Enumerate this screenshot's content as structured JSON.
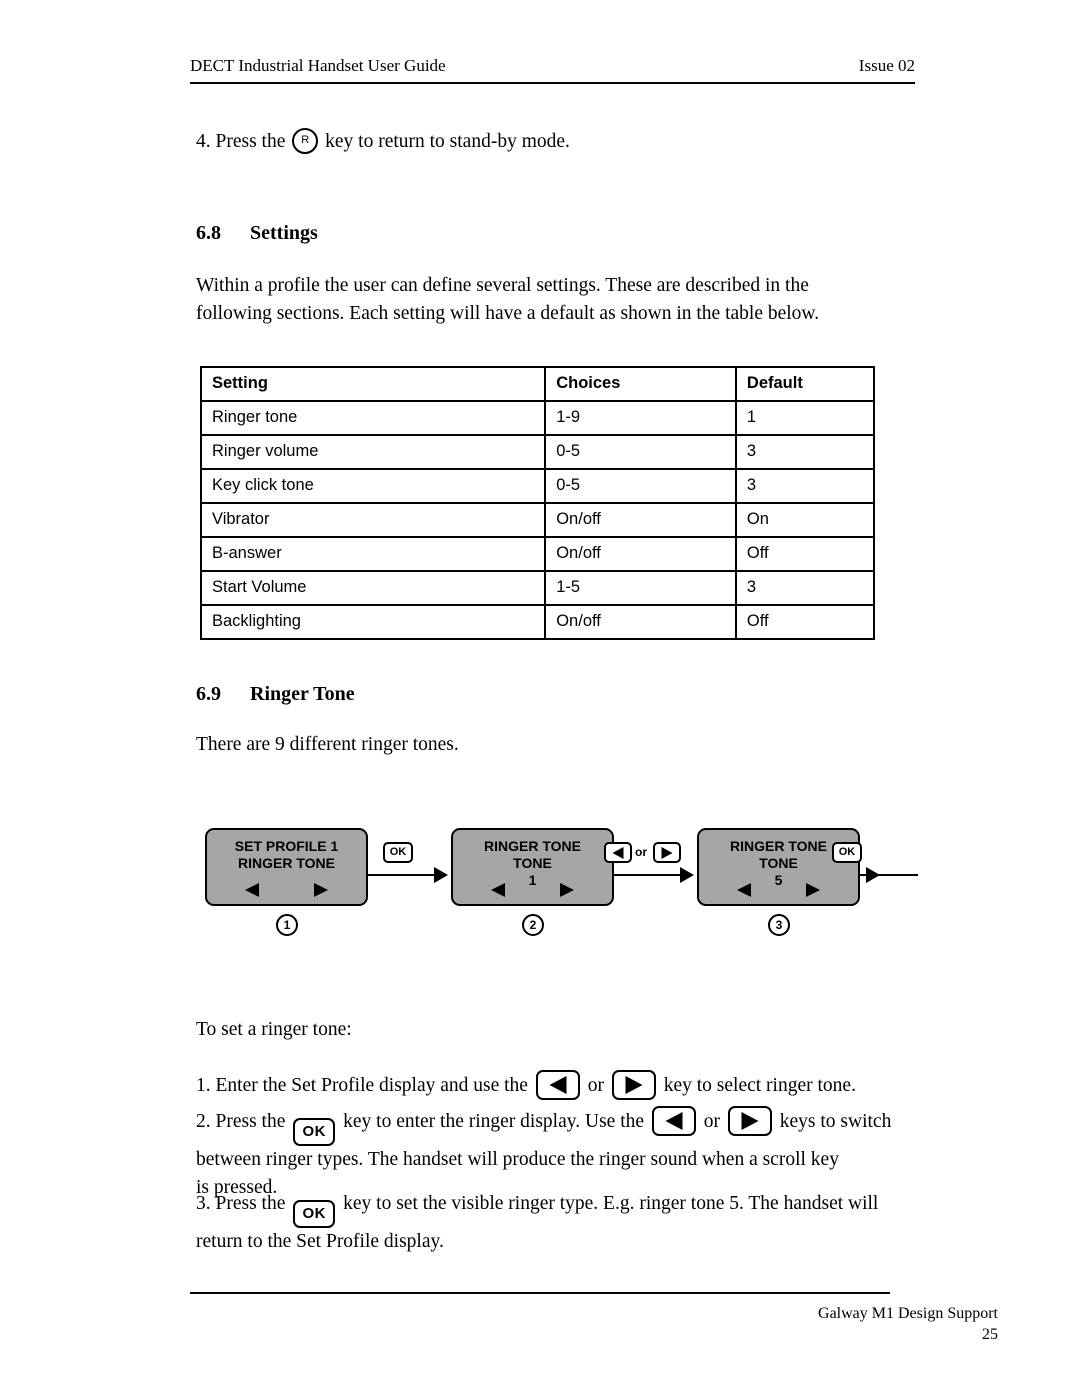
{
  "header": {
    "left_title": "DECT Industrial Handset User Guide",
    "right_issue": "Issue 02"
  },
  "intro_step": {
    "prefix": "4. Press the",
    "key_label": "R",
    "suffix": "key to return to stand-by mode."
  },
  "section_settings": {
    "number": "6.8",
    "title": "Settings",
    "paragraph_line1": "Within a profile the user can define several settings. These are described in the",
    "paragraph_line2": "following sections. Each setting will have a default as shown in the table below."
  },
  "settings_table": {
    "columns": [
      "Setting",
      "Choices",
      "Default"
    ],
    "rows": [
      [
        "Ringer tone",
        "1-9",
        "1"
      ],
      [
        "Ringer volume",
        "0-5",
        "3"
      ],
      [
        "Key click tone",
        "0-5",
        "3"
      ],
      [
        "Vibrator",
        "On/off",
        "On"
      ],
      [
        "B-answer",
        "On/off",
        "Off"
      ],
      [
        "Start Volume",
        "1-5",
        "3"
      ],
      [
        "Backlighting",
        "On/off",
        "Off"
      ]
    ]
  },
  "section_ringer_tone": {
    "number": "6.9",
    "title": "Ringer Tone",
    "paragraph": "There are 9 different ringer tones."
  },
  "flow_diagram": {
    "panel_bg_color": "#a6a6a6",
    "panels": [
      {
        "step": "1",
        "lines": [
          "SET PROFILE 1",
          "RINGER TONE"
        ],
        "softkey_left": "scroll-left-arrow",
        "softkey_right": "scroll-right-arrow"
      },
      {
        "step": "2",
        "lines": [
          "RINGER TONE",
          "TONE",
          "1"
        ],
        "softkey_left": "scroll-left-arrow",
        "softkey_right": "scroll-right-arrow"
      },
      {
        "step": "3",
        "lines": [
          "RINGER TONE",
          "TONE",
          "5"
        ],
        "softkey_left": "scroll-left-arrow",
        "softkey_right": "scroll-right-arrow"
      }
    ],
    "transitions": [
      {
        "key": "OK"
      },
      {
        "key_left": "left-arrow",
        "joiner": "or",
        "key_right": "right-arrow"
      },
      {
        "key": "OK"
      }
    ]
  },
  "instructions": {
    "lead_in": "To set a ringer tone:",
    "step1": {
      "prefix": "1. Enter the Set Profile display and use the",
      "joiner": "or",
      "suffix": "key to select ringer tone."
    },
    "step2": {
      "part1": "2. Press the",
      "part2": "key to enter the ringer display. Use the",
      "joiner": "or",
      "part3": "keys to switch",
      "line2": "between ringer types. The handset will produce the ringer sound when a scroll key",
      "line3": "is pressed."
    },
    "step3": {
      "prefix": "3. Press the",
      "suffix": "key to set the visible ringer type. E.g. ringer tone 5. The handset will",
      "line2": "return to the Set Profile display."
    }
  },
  "footer": {
    "credit": "Galway M1 Design Support",
    "page_number": "25"
  }
}
